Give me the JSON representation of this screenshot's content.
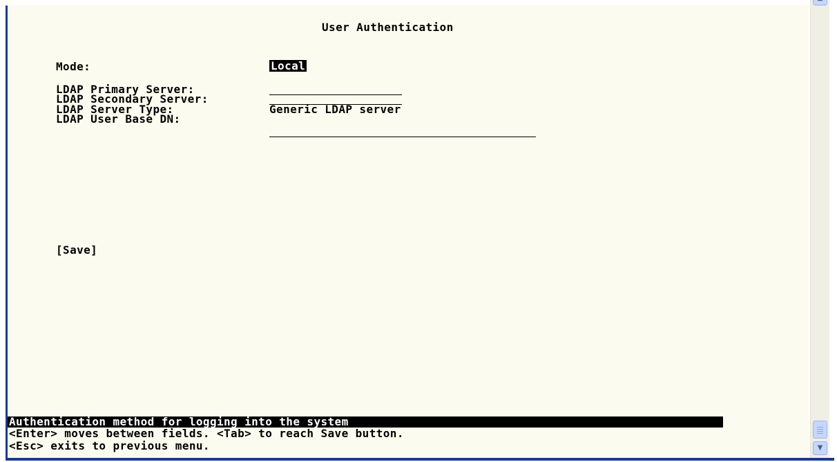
{
  "screen": {
    "title": "User Authentication",
    "mode": {
      "label": "Mode:",
      "value": "Local"
    },
    "fields": [
      {
        "label": "LDAP Primary Server:",
        "value": ""
      },
      {
        "label": "LDAP Secondary Server:",
        "value": ""
      },
      {
        "label": "LDAP Server Type:",
        "value": "Generic LDAP server"
      },
      {
        "label": "LDAP User Base DN:",
        "value": ""
      }
    ],
    "save_label": "[Save]"
  },
  "status_bar": {
    "help_text": "Authentication method for logging into the system",
    "hint_line1": "<Enter> moves between fields. <Tab> to reach Save button.",
    "hint_line2": "<Esc> exits to previous menu."
  },
  "scrollbar": {
    "up_icon": "chevron-up-icon",
    "down_icon": "chevron-down-icon"
  },
  "colors": {
    "terminal_background": "#fbfbef",
    "highlight_background": "#000000",
    "highlight_text": "#ffffff",
    "frame": "#1b3a8c"
  }
}
